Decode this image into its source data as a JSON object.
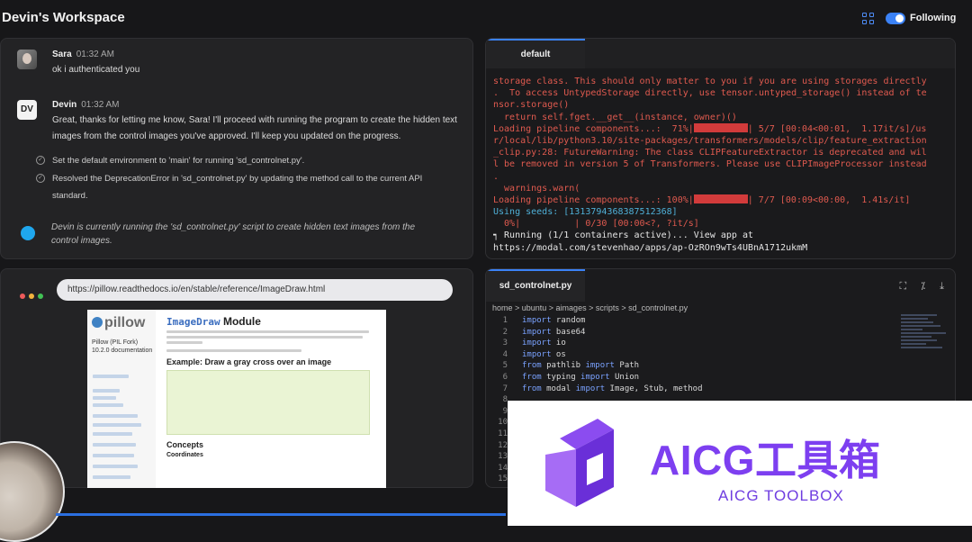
{
  "header": {
    "title": "Devin's Workspace",
    "following_label": "Following",
    "following_on": true,
    "accent": "#3b82f6"
  },
  "chat": {
    "messages": [
      {
        "author": "Sara",
        "time": "01:32 AM",
        "text": "ok i authenticated you"
      },
      {
        "author": "Devin",
        "avatar": "DV",
        "time": "01:32 AM",
        "text": "Great, thanks for letting me know, Sara! I'll proceed with running the program to create the hidden text images from the control images you've approved. I'll keep you updated on the progress."
      }
    ],
    "checklist": [
      "Set the default environment to 'main' for running 'sd_controlnet.py'.",
      "Resolved the DeprecationError in 'sd_controlnet.py' by updating the method call to the current API standard."
    ],
    "status": "Devin is currently running the 'sd_controlnet.py' script to create hidden text images from the control images."
  },
  "browser": {
    "url": "https://pillow.readthedocs.io/en/stable/reference/ImageDraw.html",
    "page": {
      "logo": "pillow",
      "project": "Pillow (PIL Fork) 10.2.0 documentation",
      "title_code": "ImageDraw",
      "title_rest": " Module",
      "example_heading": "Example: Draw a gray cross over an image",
      "concepts_heading": "Concepts",
      "coordinates_heading": "Coordinates"
    }
  },
  "terminal": {
    "tab": "default",
    "lines": [
      {
        "t": "storage class. This should only matter to you if you are using storages directly",
        "c": "#e05a4f"
      },
      {
        "t": ".  To access UntypedStorage directly, use tensor.untyped_storage() instead of te",
        "c": "#e05a4f"
      },
      {
        "t": "nsor.storage()",
        "c": "#e05a4f"
      },
      {
        "t": "  return self.fget.__get__(instance, owner)()",
        "c": "#e05a4f"
      },
      {
        "t": "Loading pipeline components...:  71%|",
        "bar": true,
        "t2": "| 5/7 [00:04<00:01,  1.17it/s]/us",
        "c": "#e05a4f"
      },
      {
        "t": "r/local/lib/python3.10/site-packages/transformers/models/clip/feature_extraction",
        "c": "#e05a4f"
      },
      {
        "t": "_clip.py:28: FutureWarning: The class CLIPFeatureExtractor is deprecated and wil",
        "c": "#e05a4f"
      },
      {
        "t": "l be removed in version 5 of Transformers. Please use CLIPImageProcessor instead",
        "c": "#e05a4f"
      },
      {
        "t": ".",
        "c": "#e05a4f"
      },
      {
        "t": "  warnings.warn(",
        "c": "#e05a4f"
      },
      {
        "t": "Loading pipeline components...: 100%|",
        "bar": true,
        "t2": "| 7/7 [00:09<00:00,  1.41s/it]",
        "c": "#e05a4f"
      },
      {
        "t": "Using seeds: [1313794368387512368]",
        "c": "#4fb0d8"
      },
      {
        "t": "  0%|          | 0/30 [00:00<?, ?it/s]",
        "c": "#e05a4f"
      },
      {
        "t": "┑ Running (1/1 containers active)... View app at",
        "c": "#e6e6e6"
      },
      {
        "t": "https://modal.com/stevenhao/apps/ap-OzROn9wTs4UBnA1712ukmM",
        "c": "#e6e6e6"
      }
    ]
  },
  "editor": {
    "tab": "sd_controlnet.py",
    "breadcrumb": "home > ubuntu > aimages > scripts > sd_controlnet.py",
    "lines": [
      {
        "n": "1",
        "kw": "import",
        "rest": " random"
      },
      {
        "n": "2",
        "kw": "import",
        "rest": " base64"
      },
      {
        "n": "3",
        "kw": "import",
        "rest": " io"
      },
      {
        "n": "4",
        "kw": "import",
        "rest": " os"
      },
      {
        "n": "5",
        "kw": "from",
        "rest": " pathlib ",
        "kw2": "import",
        "rest2": " Path"
      },
      {
        "n": "6",
        "kw": "from",
        "rest": " typing ",
        "kw2": "import",
        "rest2": " Union"
      },
      {
        "n": "7",
        "kw": "from",
        "rest": " modal ",
        "kw2": "import",
        "rest2": " Image, Stub, method"
      },
      {
        "n": "8",
        "kw": "",
        "rest": ""
      },
      {
        "n": "9",
        "kw": "",
        "rest": ""
      },
      {
        "n": "10",
        "kw": "",
        "rest": ""
      },
      {
        "n": "11",
        "kw": "",
        "rest": ""
      },
      {
        "n": "12",
        "kw": "",
        "rest": ""
      },
      {
        "n": "13",
        "kw": "",
        "rest": ""
      },
      {
        "n": "14",
        "kw": "",
        "rest": ""
      },
      {
        "n": "15",
        "kw": "",
        "rest": ""
      }
    ]
  },
  "watermark": {
    "title": "AICG工具箱",
    "subtitle": "AICG TOOLBOX",
    "color": "#7d3ff0"
  }
}
